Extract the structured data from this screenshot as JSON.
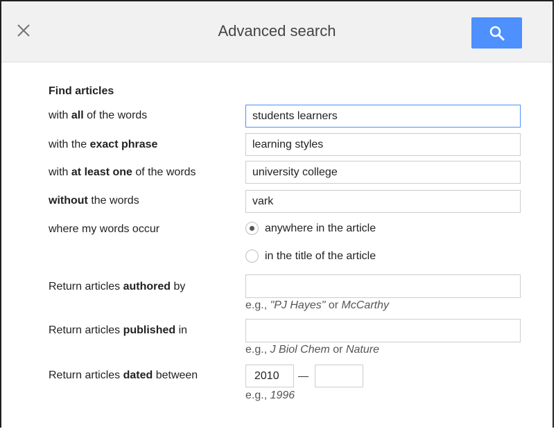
{
  "header": {
    "title": "Advanced search",
    "close_icon": "close-icon",
    "search_icon": "search-icon",
    "accent_color": "#4d90fe"
  },
  "find_articles": {
    "section_title": "Find articles",
    "all_words": {
      "label_pre": "with ",
      "label_bold": "all",
      "label_post": " of the words",
      "value": "students learners"
    },
    "exact_phrase": {
      "label_pre": "with the ",
      "label_bold": "exact phrase",
      "label_post": "",
      "value": "learning styles"
    },
    "at_least_one": {
      "label_pre": "with ",
      "label_bold": "at least one",
      "label_post": " of the words",
      "value": "university college"
    },
    "without": {
      "label_pre": "",
      "label_bold": "without",
      "label_post": " the words",
      "value": "vark"
    },
    "occur": {
      "label": "where my words occur",
      "options": [
        {
          "label": "anywhere in the article",
          "checked": true
        },
        {
          "label": "in the title of the article",
          "checked": false
        }
      ]
    }
  },
  "authored": {
    "label_pre": "Return articles ",
    "label_bold": "authored",
    "label_post": " by",
    "value": "",
    "hint_pre": "e.g., ",
    "hint_italic_1": "\"PJ Hayes\"",
    "hint_mid": " or ",
    "hint_italic_2": "McCarthy"
  },
  "published": {
    "label_pre": "Return articles ",
    "label_bold": "published",
    "label_post": " in",
    "value": "",
    "hint_pre": "e.g., ",
    "hint_italic_1": "J Biol Chem",
    "hint_mid": " or ",
    "hint_italic_2": "Nature"
  },
  "dated": {
    "label_pre": "Return articles ",
    "label_bold": "dated",
    "label_post": " between",
    "from_value": "2010",
    "to_value": "",
    "hint_pre": "e.g., ",
    "hint_italic": "1996"
  }
}
